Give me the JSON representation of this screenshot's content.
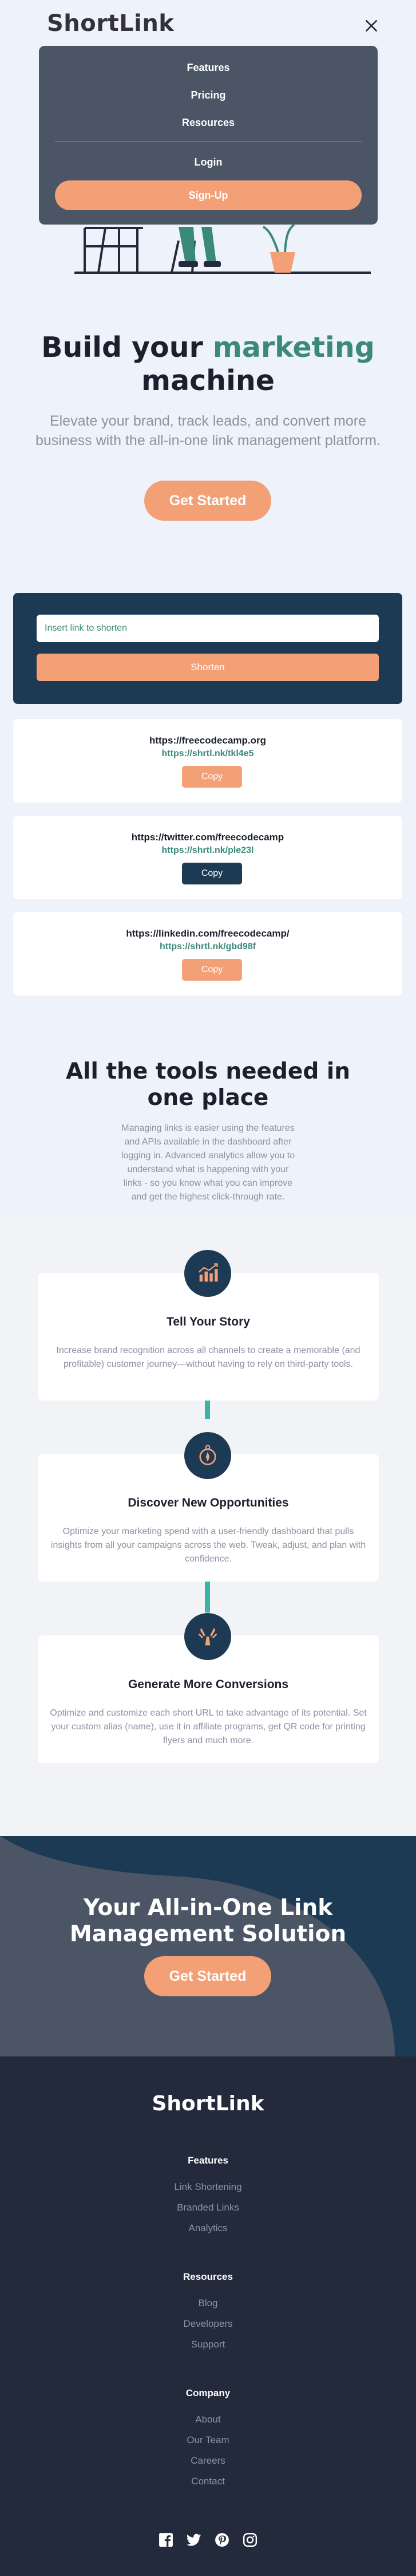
{
  "header": {
    "logo": "ShortLink"
  },
  "menu": {
    "items": [
      {
        "label": "Features"
      },
      {
        "label": "Pricing"
      },
      {
        "label": "Resources"
      }
    ],
    "login": "Login",
    "signup": "Sign-Up"
  },
  "hero": {
    "title_pre": "Build your",
    "title_accent": "marketing",
    "title_post": "machine",
    "subtitle": "Elevate your brand, track leads, and convert more business with the all-in-one link management platform.",
    "cta": "Get Started"
  },
  "shorten": {
    "placeholder": "Insert link to shorten",
    "button": "Shorten"
  },
  "results": [
    {
      "original": "https://freecodecamp.org",
      "short": "https://shrtl.nk/tkl4e5",
      "copy": "Copy",
      "copied": false
    },
    {
      "original": "https://twitter.com/freecodecamp",
      "short": "https://shrtl.nk/ple23l",
      "copy": "Copy",
      "copied": true
    },
    {
      "original": "https://linkedin.com/freecodecamp/",
      "short": "https://shrtl.nk/gbd98f",
      "copy": "Copy",
      "copied": false
    }
  ],
  "features": {
    "title": "All the tools needed in one place",
    "description": "Managing links is easier using the features and APIs available in the dashboard after logging in. Advanced analytics allow you to understand what is happening with your links - so you know what you can improve and get the highest click-through rate.",
    "cards": [
      {
        "icon": "chart-icon",
        "title": "Tell Your Story",
        "text": "Increase brand recognition across all channels to create a memorable (and profitable) customer journey—without having to rely on third-party tools."
      },
      {
        "icon": "compass-icon",
        "title": "Discover New Opportunities",
        "text": "Optimize your marketing spend with a user-friendly dashboard that pulls insights from all your campaigns across the web. Tweak, adjust, and plan with confidence."
      },
      {
        "icon": "tools-icon",
        "title": "Generate More Conversions",
        "text": "Optimize and customize each short URL to take advantage of its potential. Set your custom alias (name), use it in affiliate programs, get QR code for printing flyers and much more."
      }
    ]
  },
  "boost": {
    "title": "Your All-in-One Link Management Solution",
    "cta": "Get Started"
  },
  "footer": {
    "logo": "ShortLink",
    "columns": [
      {
        "heading": "Features",
        "links": [
          "Link Shortening",
          "Branded Links",
          "Analytics"
        ]
      },
      {
        "heading": "Resources",
        "links": [
          "Blog",
          "Developers",
          "Support"
        ]
      },
      {
        "heading": "Company",
        "links": [
          "About",
          "Our Team",
          "Careers",
          "Contact"
        ]
      }
    ],
    "social": [
      "facebook-icon",
      "twitter-icon",
      "pinterest-icon",
      "instagram-icon"
    ]
  },
  "colors": {
    "accent": "#3b8a79",
    "orange": "#f4a076",
    "navy": "#1d3a55",
    "teal": "#3db3a7",
    "footer_bg": "#232a3b"
  }
}
